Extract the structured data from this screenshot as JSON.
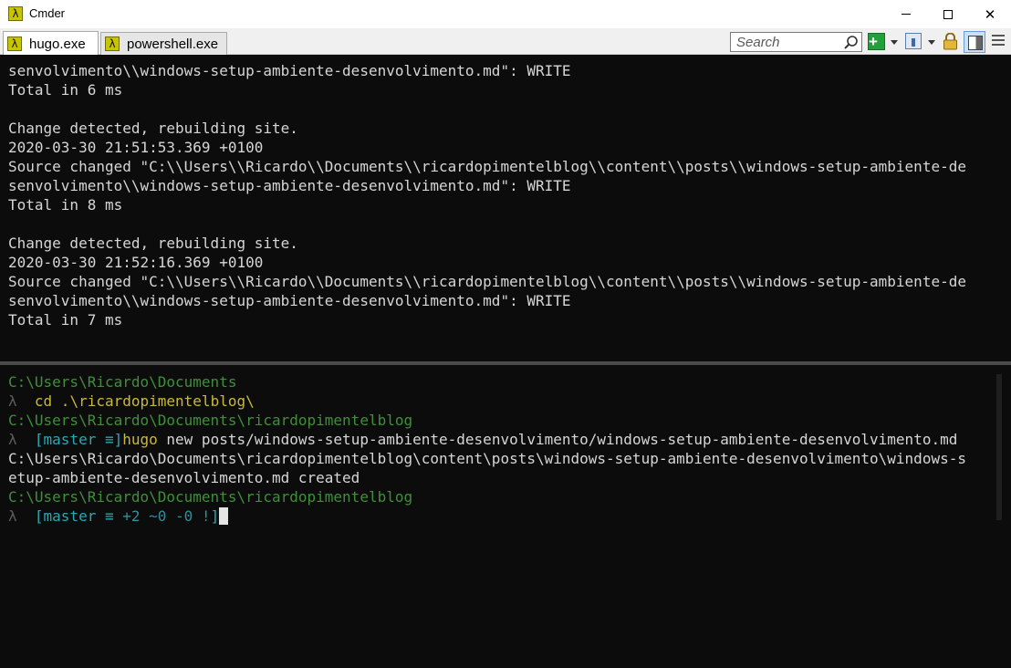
{
  "window": {
    "title": "Cmder"
  },
  "tabs": [
    {
      "label": "hugo.exe"
    },
    {
      "label": "powershell.exe"
    }
  ],
  "toolbar": {
    "search_placeholder": "Search",
    "icons": [
      "search-icon",
      "new-console-plus-icon",
      "window-list-icon",
      "lock-icon",
      "split-panel-icon",
      "menu-icon"
    ]
  },
  "pane_top": {
    "lines": [
      "senvolvimento\\\\windows-setup-ambiente-desenvolvimento.md\": WRITE",
      "Total in 6 ms",
      "",
      "Change detected, rebuilding site.",
      "2020-03-30 21:51:53.369 +0100",
      "Source changed \"C:\\\\Users\\\\Ricardo\\\\Documents\\\\ricardopimentelblog\\\\content\\\\posts\\\\windows-setup-ambiente-de",
      "senvolvimento\\\\windows-setup-ambiente-desenvolvimento.md\": WRITE",
      "Total in 8 ms",
      "",
      "Change detected, rebuilding site.",
      "2020-03-30 21:52:16.369 +0100",
      "Source changed \"C:\\\\Users\\\\Ricardo\\\\Documents\\\\ricardopimentelblog\\\\content\\\\posts\\\\windows-setup-ambiente-de",
      "senvolvimento\\\\windows-setup-ambiente-desenvolvimento.md\": WRITE",
      "Total in 7 ms"
    ]
  },
  "pane_bottom": {
    "path1": "C:\\Users\\Ricardo\\Documents",
    "prompt_symbol": "λ",
    "cmd1": "cd .\\ricardopimentelblog\\",
    "path2": "C:\\Users\\Ricardo\\Documents\\ricardopimentelblog",
    "branch_open": "[master ≡]",
    "cmd2_prog": "hugo",
    "cmd2_args": " new posts/windows-setup-ambiente-desenvolvimento/windows-setup-ambiente-desenvolvimento.md",
    "out1": "C:\\Users\\Ricardo\\Documents\\ricardopimentelblog\\content\\posts\\windows-setup-ambiente-desenvolvimento\\windows-s",
    "out2": "etup-ambiente-desenvolvimento.md created",
    "path3": "C:\\Users\\Ricardo\\Documents\\ricardopimentelblog",
    "branch_prefix": "[master ≡ ",
    "branch_status": "+2 ~0 -0 !",
    "branch_close": "]"
  },
  "colors": {
    "terminal_bg": "#0c0c0c",
    "text": "#d6d6d6",
    "path_green": "#3f8f3a",
    "branch_cyan": "#2aa7b6",
    "command_yellow": "#c9b83d"
  }
}
